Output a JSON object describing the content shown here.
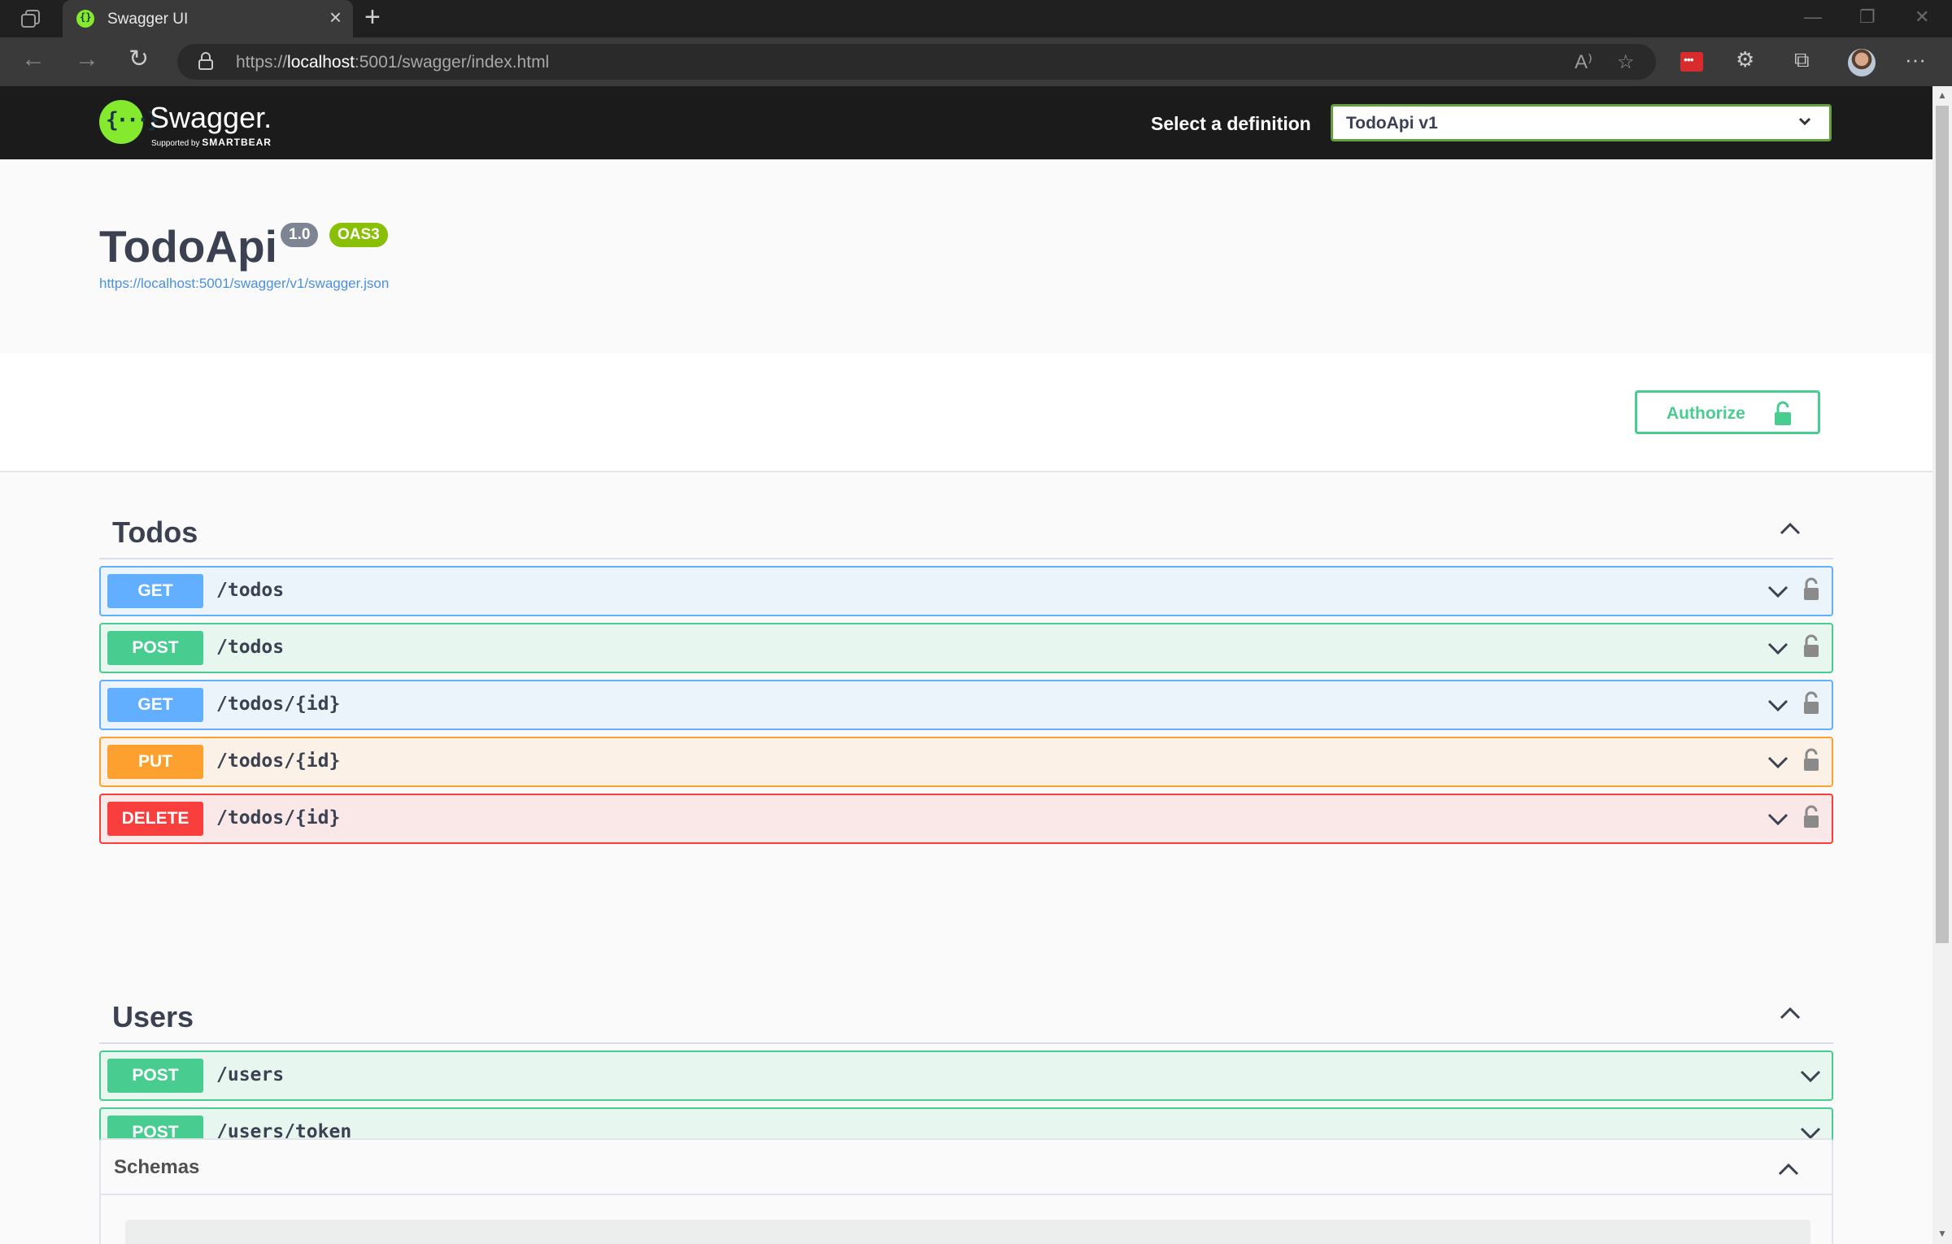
{
  "browser": {
    "tab_title": "Swagger UI",
    "new_tab": "+",
    "url_prefix": "https://",
    "url_host": "localhost",
    "url_rest": ":5001/swagger/index.html",
    "menu": "···"
  },
  "topbar": {
    "logo_glyph": "{···}",
    "logo_text": "Swagger.",
    "logo_sub_prefix": "Supported by",
    "logo_sub_brand": "SMARTBEAR",
    "definition_label": "Select a definition",
    "definition_selected": "TodoApi v1"
  },
  "info": {
    "title": "TodoApi",
    "version": "1.0",
    "oas": "OAS3",
    "spec_url": "https://localhost:5001/swagger/v1/swagger.json"
  },
  "authorize_label": "Authorize",
  "tags": [
    {
      "name": "Todos",
      "operations": [
        {
          "method": "GET",
          "path": "/todos"
        },
        {
          "method": "POST",
          "path": "/todos"
        },
        {
          "method": "GET",
          "path": "/todos/{id}"
        },
        {
          "method": "PUT",
          "path": "/todos/{id}"
        },
        {
          "method": "DELETE",
          "path": "/todos/{id}"
        }
      ]
    },
    {
      "name": "Users",
      "operations": [
        {
          "method": "POST",
          "path": "/users"
        },
        {
          "method": "POST",
          "path": "/users/token"
        }
      ]
    }
  ],
  "schemas_label": "Schemas",
  "colors": {
    "get": "#61affe",
    "post": "#49cc90",
    "put": "#fca130",
    "delete": "#f93e3e",
    "swagger_green": "#85ea2d"
  }
}
